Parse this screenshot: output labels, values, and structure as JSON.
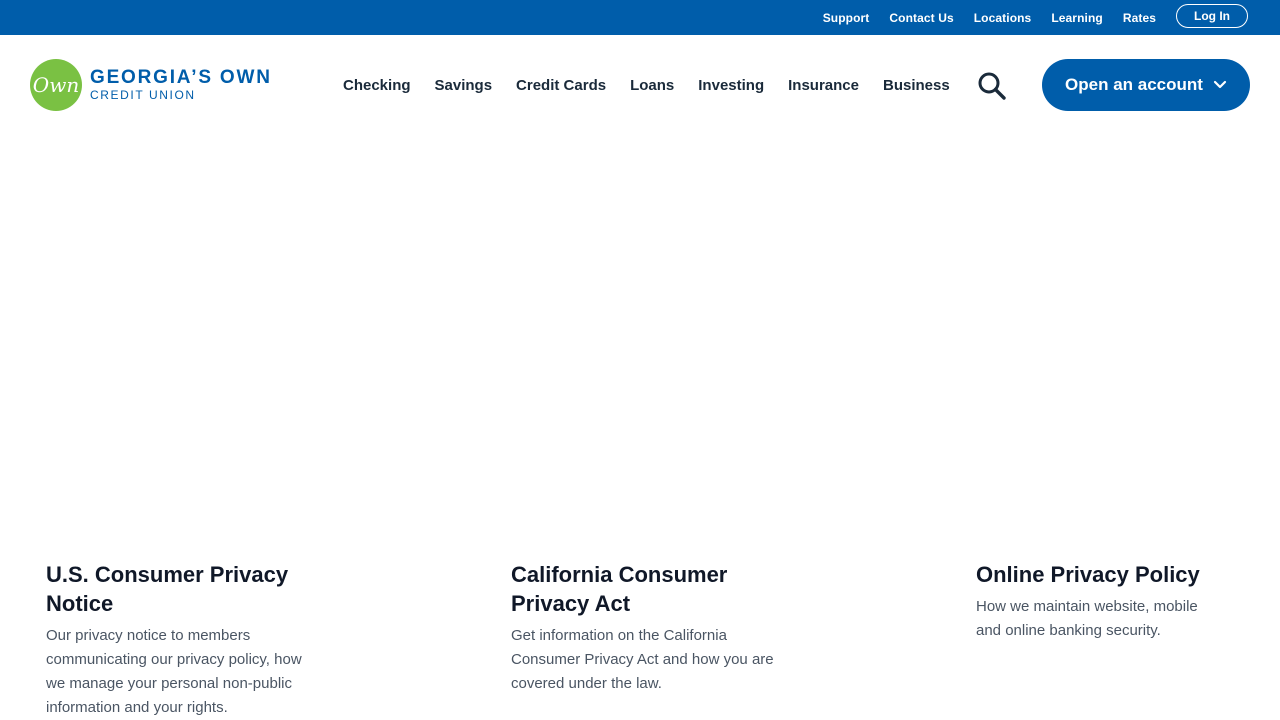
{
  "utility": {
    "links": [
      "Support",
      "Contact Us",
      "Locations",
      "Learning",
      "Rates"
    ],
    "login_label": "Log In"
  },
  "logo": {
    "mark": "Own",
    "line1": "GEORGIA’S OWN",
    "line2": "CREDIT UNION"
  },
  "nav": {
    "items": [
      "Checking",
      "Savings",
      "Credit Cards",
      "Loans",
      "Investing",
      "Insurance",
      "Business"
    ],
    "search_icon": "search-icon",
    "open_account_label": "Open an account"
  },
  "cards": [
    {
      "title": "U.S. Consumer Privacy Notice",
      "description": "Our privacy notice to members communicating our privacy policy, how we manage your personal non-public information and your rights."
    },
    {
      "title": "California Consumer Privacy Act",
      "description": "Get information on the California Consumer Privacy Act and how you are covered under the law."
    },
    {
      "title": "Online Privacy Policy",
      "description": "How we maintain website, mobile and online banking security."
    }
  ],
  "colors": {
    "brand_blue": "#005daa",
    "brand_green": "#7ac143"
  }
}
